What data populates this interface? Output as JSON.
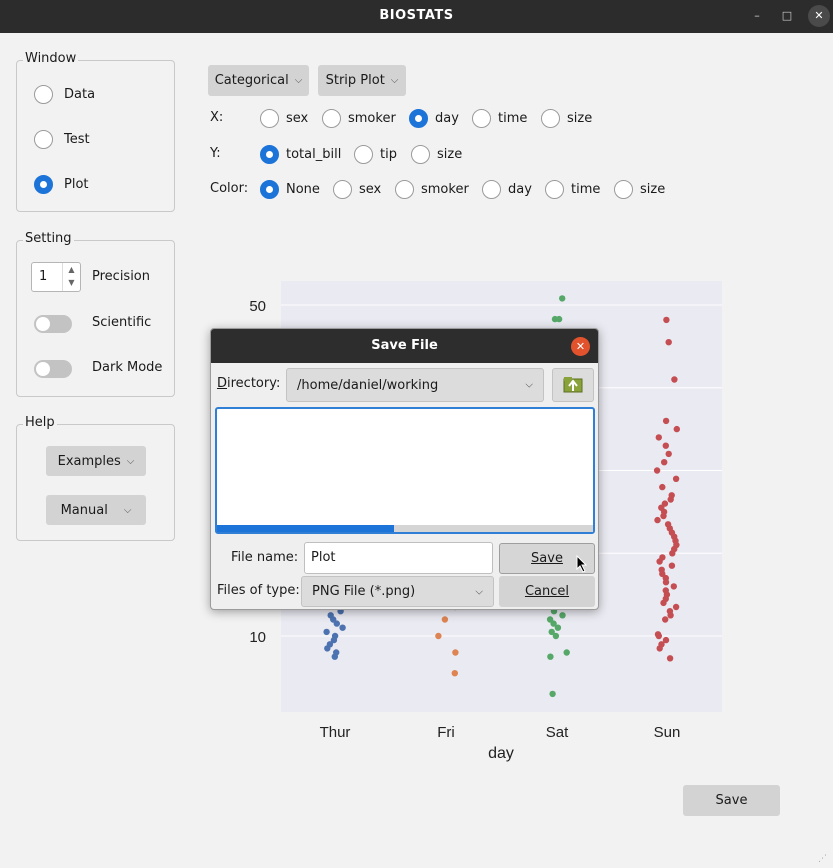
{
  "app": {
    "title": "BIOSTATS"
  },
  "window_controls": {
    "minimize": "–",
    "maximize": "□",
    "close": "✕"
  },
  "window_group": {
    "title": "Window",
    "options": [
      "Data",
      "Test",
      "Plot"
    ],
    "selected": "Plot"
  },
  "setting_group": {
    "title": "Setting",
    "precision_value": "1",
    "precision_label": "Precision",
    "scientific_label": "Scientific",
    "dark_mode_label": "Dark Mode"
  },
  "help_group": {
    "title": "Help",
    "examples": "Examples",
    "manual": "Manual"
  },
  "plot_controls": {
    "category_select": "Categorical",
    "plot_type_select": "Strip Plot",
    "x_label": "X:",
    "x_options": [
      "sex",
      "smoker",
      "day",
      "time",
      "size"
    ],
    "x_selected": "day",
    "y_label": "Y:",
    "y_options": [
      "total_bill",
      "tip",
      "size"
    ],
    "y_selected": "total_bill",
    "color_label": "Color:",
    "color_options": [
      "None",
      "sex",
      "smoker",
      "day",
      "time",
      "size"
    ],
    "color_selected": "None"
  },
  "save_button": "Save",
  "chart_data": {
    "type": "scatter",
    "subtype": "strip",
    "xlabel": "day",
    "categories": [
      "Thur",
      "Fri",
      "Sat",
      "Sun"
    ],
    "ytick_labels": [
      "10",
      "50"
    ],
    "colors": {
      "Thur": "#4c72b0",
      "Fri": "#dd8452",
      "Sat": "#55a868",
      "Sun": "#c44e52"
    },
    "ylim": [
      0,
      55
    ],
    "series": [
      {
        "category": "Thur",
        "values": [
          7.5,
          8.0,
          8.5,
          9.0,
          9.5,
          10.0,
          10.5,
          11.0,
          11.5,
          12.0,
          12.5,
          13.0,
          14.0,
          14.5,
          15.0,
          15.5,
          16.0,
          17.0,
          17.5,
          18.0,
          19.0,
          20.0
        ]
      },
      {
        "category": "Fri",
        "values": [
          5.5,
          8.0,
          10.0,
          12.0,
          13.5,
          15.0,
          16.0,
          17.0,
          18.0
        ]
      },
      {
        "category": "Sat",
        "values": [
          3.0,
          7.5,
          8.0,
          10.0,
          10.5,
          11.0,
          11.5,
          12.0,
          12.5,
          13.0,
          13.5,
          14.0,
          15.0,
          16.0,
          17.0,
          18.0,
          20.0,
          48.3,
          48.3,
          50.8
        ]
      },
      {
        "category": "Sun",
        "values": [
          7.3,
          8.5,
          9.0,
          9.5,
          10.0,
          10.2,
          12.0,
          12.5,
          13.0,
          13.5,
          14.0,
          14.5,
          15.0,
          15.5,
          16.0,
          16.5,
          17.0,
          17.5,
          18.0,
          18.5,
          19.0,
          19.5,
          20.0,
          20.5,
          21.0,
          21.5,
          22.0,
          22.5,
          23.0,
          23.5,
          24.0,
          24.5,
          25.0,
          25.5,
          26.0,
          26.5,
          27.0,
          28.0,
          29.0,
          30.0,
          31.0,
          32.0,
          33.0,
          34.0,
          35.0,
          36.0,
          41.0,
          45.5,
          48.2
        ]
      }
    ]
  },
  "save_dialog": {
    "title": "Save File",
    "directory_label": "Directory:",
    "directory_value": "/home/daniel/working",
    "filename_label": "File name:",
    "filename_value": "Plot",
    "filetype_label": "Files of type:",
    "filetype_value": "PNG File (*.png)",
    "save_button": "Save",
    "cancel_button": "Cancel",
    "progress": 0.47
  }
}
